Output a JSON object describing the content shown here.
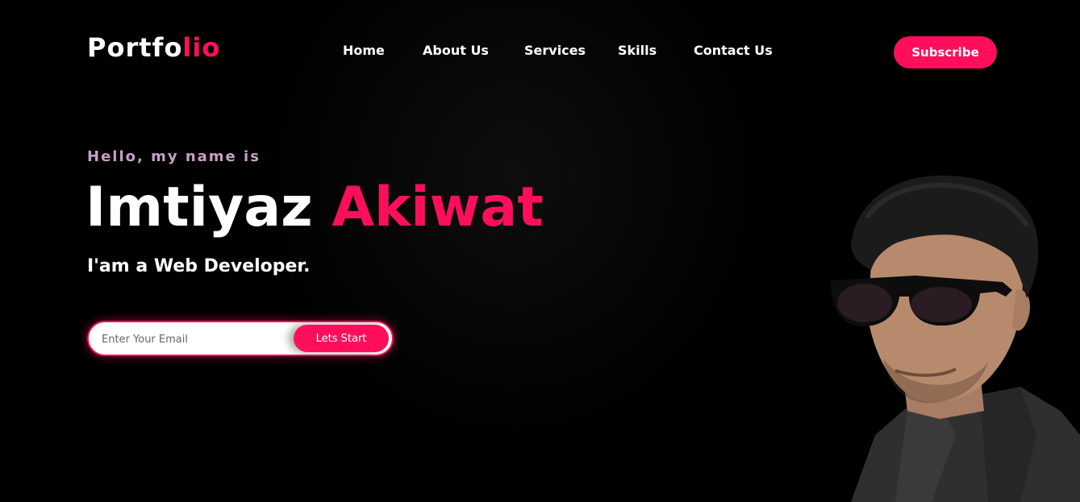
{
  "logo": {
    "text_main": "Portfo",
    "text_accent": "lio"
  },
  "nav": {
    "items": [
      {
        "label": "Home"
      },
      {
        "label": "About Us"
      },
      {
        "label": "Services"
      },
      {
        "label": "Skills"
      },
      {
        "label": "Contact Us"
      }
    ]
  },
  "subscribe_label": "Subscribe",
  "hero": {
    "greeting": "Hello, my name is",
    "first_name": "Imtiyaz",
    "last_name": "Akiwat",
    "role": "I'am a Web Developer.",
    "email_placeholder": "Enter Your Email",
    "cta_label": "Lets Start"
  },
  "colors": {
    "accent": "#ff0f5b",
    "background": "#000000",
    "greeting": "#c89fc9"
  },
  "icons": [
    "person-portrait"
  ]
}
